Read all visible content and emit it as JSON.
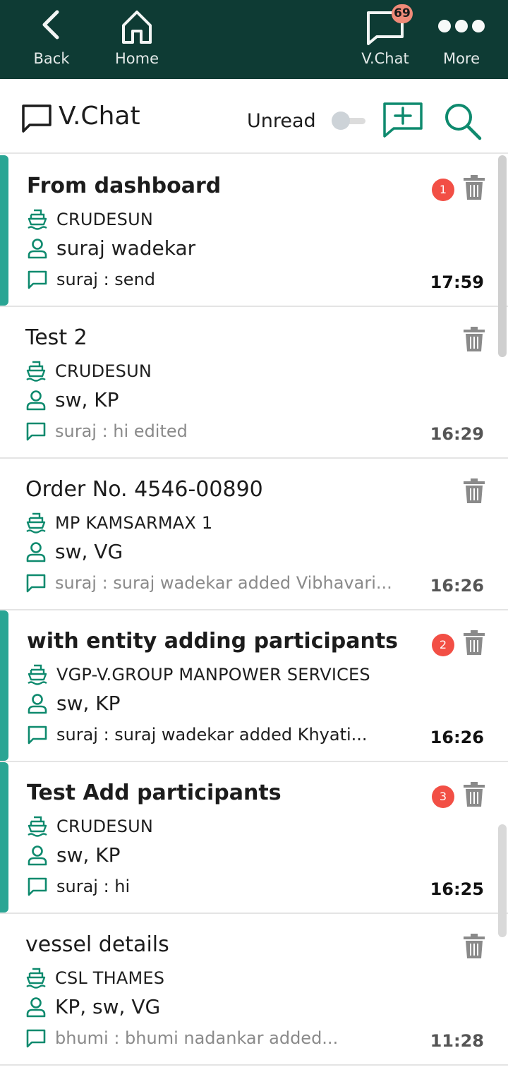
{
  "nav": {
    "back_label": "Back",
    "home_label": "Home",
    "vchat_label": "V.Chat",
    "vchat_badge": "69",
    "more_label": "More"
  },
  "header": {
    "title": "V.Chat",
    "unread_label": "Unread",
    "unread_toggle_on": false
  },
  "chats": [
    {
      "title": "From dashboard",
      "vessel": "CRUDESUN",
      "participants": "suraj wadekar",
      "last_message": "suraj : send",
      "time": "17:59",
      "unread_count": "1",
      "unread": true
    },
    {
      "title": "Test 2",
      "vessel": "CRUDESUN",
      "participants": "sw, KP",
      "last_message": "suraj : hi edited",
      "time": "16:29",
      "unread_count": "",
      "unread": false
    },
    {
      "title": "Order No. 4546-00890",
      "vessel": "MP KAMSARMAX 1",
      "participants": "sw, VG",
      "last_message": "suraj : suraj wadekar added Vibhavari...",
      "time": "16:26",
      "unread_count": "",
      "unread": false
    },
    {
      "title": "with entity adding participants",
      "vessel": "VGP-V.GROUP MANPOWER SERVICES",
      "participants": "sw, KP",
      "last_message": "suraj : suraj wadekar added Khyati...",
      "time": "16:26",
      "unread_count": "2",
      "unread": true
    },
    {
      "title": "Test Add participants",
      "vessel": "CRUDESUN",
      "participants": "sw, KP",
      "last_message": "suraj : hi",
      "time": "16:25",
      "unread_count": "3",
      "unread": true
    },
    {
      "title": "vessel details",
      "vessel": "CSL THAMES",
      "participants": "KP, sw, VG",
      "last_message": "bhumi : bhumi nadankar added...",
      "time": "11:28",
      "unread_count": "",
      "unread": false
    }
  ],
  "icons": {
    "back": "chevron-left-icon",
    "home": "home-icon",
    "vchat": "chat-bubble-icon",
    "more": "more-dots-icon",
    "new_chat": "chat-plus-icon",
    "search": "search-icon",
    "vessel": "ship-icon",
    "participants": "person-icon",
    "message": "message-icon",
    "delete": "trash-icon"
  },
  "colors": {
    "nav_background": "#0e3b34",
    "accent_green": "#0e8a6e",
    "unread_bar": "#2aa594",
    "badge_red": "#f24f45",
    "nav_badge": "#f08a78"
  }
}
